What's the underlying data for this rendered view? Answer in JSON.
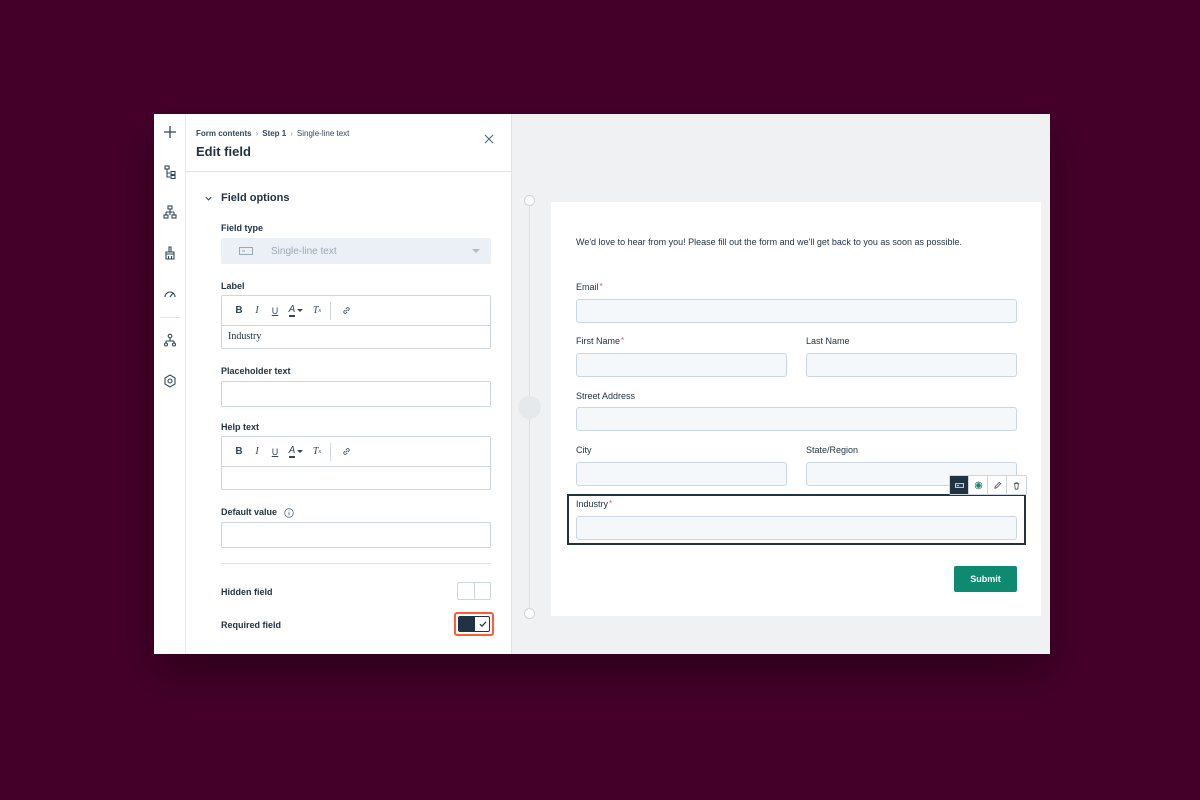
{
  "colors": {
    "backdrop": "#45002a",
    "accent_required_highlight": "#ff5c35",
    "submit_button": "#0d8a6f",
    "required_asterisk": "#f2545b",
    "text_dark": "#213343"
  },
  "rail": {
    "icons": [
      "plus-icon",
      "tree-list-icon",
      "hierarchy-icon",
      "paint-brush-icon",
      "speedometer-icon",
      "org-chart-icon",
      "settings-gear-icon"
    ]
  },
  "panel": {
    "breadcrumb": [
      "Form contents",
      "Step 1",
      "Single-line text"
    ],
    "title": "Edit field",
    "section_title": "Field options",
    "field_type": {
      "label": "Field type",
      "value": "Single-line text"
    },
    "label_field": {
      "label": "Label",
      "value": "Industry"
    },
    "placeholder_field": {
      "label": "Placeholder text",
      "value": ""
    },
    "help_field": {
      "label": "Help text",
      "value": ""
    },
    "default_field": {
      "label": "Default value",
      "value": ""
    },
    "hidden_field": {
      "label": "Hidden field",
      "checked": false
    },
    "required_field": {
      "label": "Required field",
      "checked": true
    }
  },
  "form": {
    "intro": "We'd love to hear from you! Please fill out the form and we'll get back to you as soon as possible.",
    "email_label": "Email",
    "first_name_label": "First Name",
    "last_name_label": "Last Name",
    "street_label": "Street Address",
    "city_label": "City",
    "state_label": "State/Region",
    "industry_label": "Industry",
    "required_marker": "*",
    "submit_label": "Submit"
  }
}
